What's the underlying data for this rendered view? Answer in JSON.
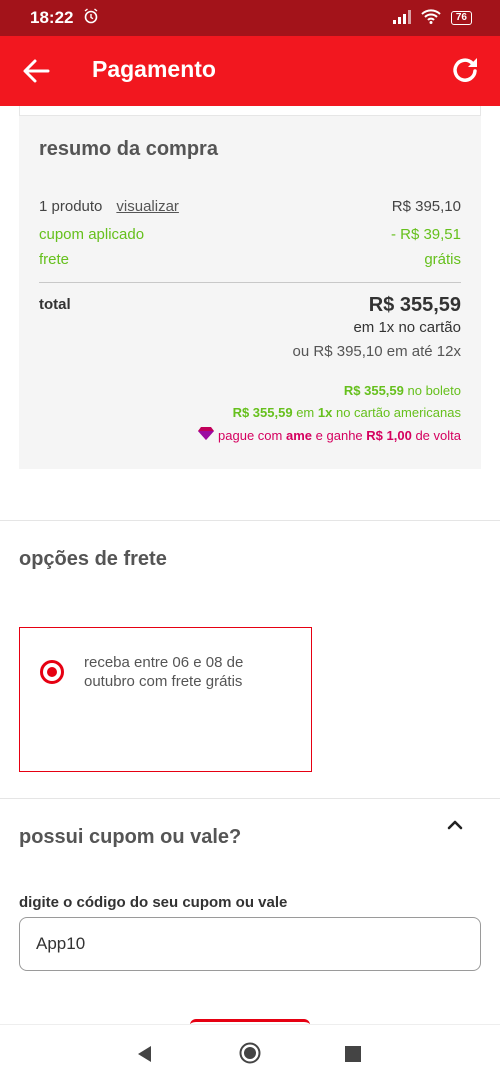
{
  "status_bar": {
    "time": "18:22",
    "battery": "76"
  },
  "app_bar": {
    "title": "Pagamento"
  },
  "summary": {
    "title": "resumo da compra",
    "product_count": "1 produto",
    "view_link": "visualizar",
    "product_price": "R$ 395,10",
    "coupon_label": "cupom aplicado",
    "coupon_value": "- R$ 39,51",
    "shipping_label": "frete",
    "shipping_value": "grátis",
    "total_label": "total",
    "total_value": "R$ 355,59",
    "total_sub": "em 1x no cartão",
    "installments": "ou R$ 395,10 em até 12x",
    "boleto_price": "R$ 355,59",
    "boleto_text": "no boleto",
    "card_price": "R$ 355,59",
    "card_mid": "em",
    "card_times": "1x",
    "card_text": "no cartão americanas",
    "ame_prefix": "pague com",
    "ame_brand": "ame",
    "ame_mid": "e ganhe",
    "ame_value": "R$ 1,00",
    "ame_suffix": "de volta"
  },
  "shipping": {
    "title": "opções de frete",
    "option_text": "receba entre 06 e 08 de outubro com frete grátis"
  },
  "coupon": {
    "title": "possui cupom ou vale?",
    "field_label": "digite o código do seu cupom ou vale",
    "field_value": "App10"
  },
  "colors": {
    "primary": "#f2171f",
    "status": "#a3131a",
    "green": "#66c01d",
    "ame": "#d5005f"
  }
}
